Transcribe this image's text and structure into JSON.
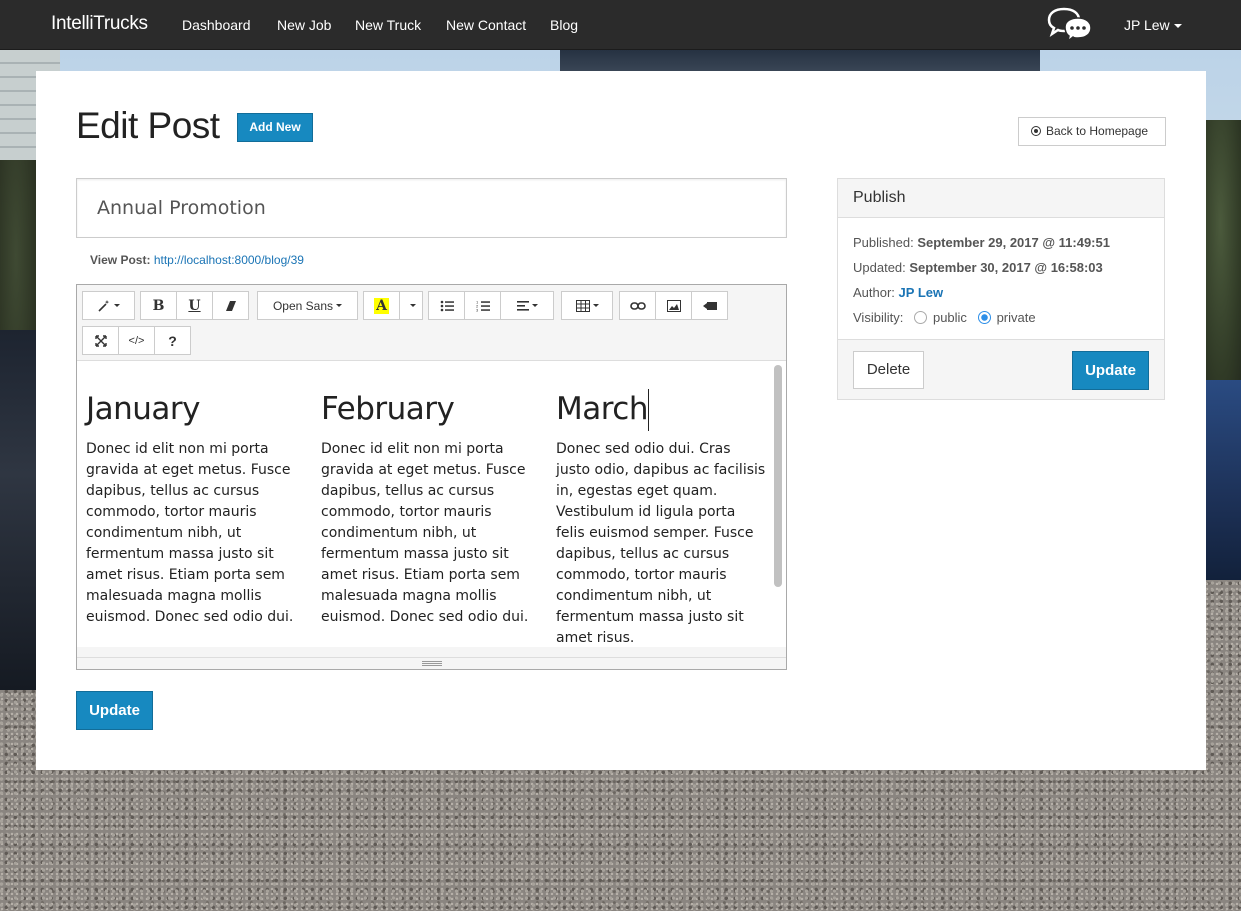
{
  "navbar": {
    "brand": "IntelliTrucks",
    "items": [
      {
        "label": "Dashboard"
      },
      {
        "label": "New Job"
      },
      {
        "label": "New Truck"
      },
      {
        "label": "New Contact"
      },
      {
        "label": "Blog"
      }
    ],
    "chat_icon": "chat-bubbles-icon",
    "user": "JP Lew"
  },
  "page": {
    "title": "Edit Post",
    "add_new_label": "Add New",
    "back_label": "Back to Homepage"
  },
  "post": {
    "title_value": "Annual Promotion",
    "view_post_label": "View Post:",
    "view_post_url": "http://localhost:8000/blog/39"
  },
  "toolbar": {
    "font_name": "Open Sans",
    "bold": "B",
    "underline": "U",
    "code": "</>",
    "help": "?",
    "icons": [
      "magic-wand-icon",
      "bold-icon",
      "underline-icon",
      "eraser-icon",
      "font-family-dropdown",
      "font-color-icon",
      "color-dropdown-icon",
      "unordered-list-icon",
      "ordered-list-icon",
      "align-icon",
      "table-icon",
      "link-icon",
      "picture-icon",
      "video-icon",
      "fullscreen-icon",
      "codeview-icon",
      "help-icon"
    ]
  },
  "content": {
    "columns": [
      {
        "heading": "January",
        "text": "Donec id elit non mi porta gravida at eget metus. Fusce dapibus, tellus ac cursus commodo, tortor mauris condimentum nibh, ut fermentum massa justo sit amet risus. Etiam porta sem malesuada magna mollis euismod. Donec sed odio dui."
      },
      {
        "heading": "February",
        "text": "Donec id elit non mi porta gravida at eget metus. Fusce dapibus, tellus ac cursus commodo, tortor mauris condimentum nibh, ut fermentum massa justo sit amet risus. Etiam porta sem malesuada magna mollis euismod. Donec sed odio dui."
      },
      {
        "heading": "March",
        "text": "Donec sed odio dui. Cras justo odio, dapibus ac facilisis in, egestas eget quam. Vestibulum id ligula porta felis euismod semper. Fusce dapibus, tellus ac cursus commodo, tortor mauris condimentum nibh, ut fermentum massa justo sit amet risus."
      }
    ]
  },
  "actions": {
    "update_label": "Update"
  },
  "publish": {
    "heading": "Publish",
    "published_label": "Published:",
    "published_value": "September 29, 2017 @ 11:49:51",
    "updated_label": "Updated:",
    "updated_value": "September 30, 2017 @ 16:58:03",
    "author_label": "Author:",
    "author_value": "JP Lew",
    "visibility_label": "Visibility:",
    "visibility_options": [
      "public",
      "private"
    ],
    "visibility_selected": "private",
    "delete_label": "Delete",
    "update_label": "Update"
  },
  "colors": {
    "primary": "#1789c0",
    "navbar": "#2b2b2b",
    "link": "#1a74b5"
  }
}
